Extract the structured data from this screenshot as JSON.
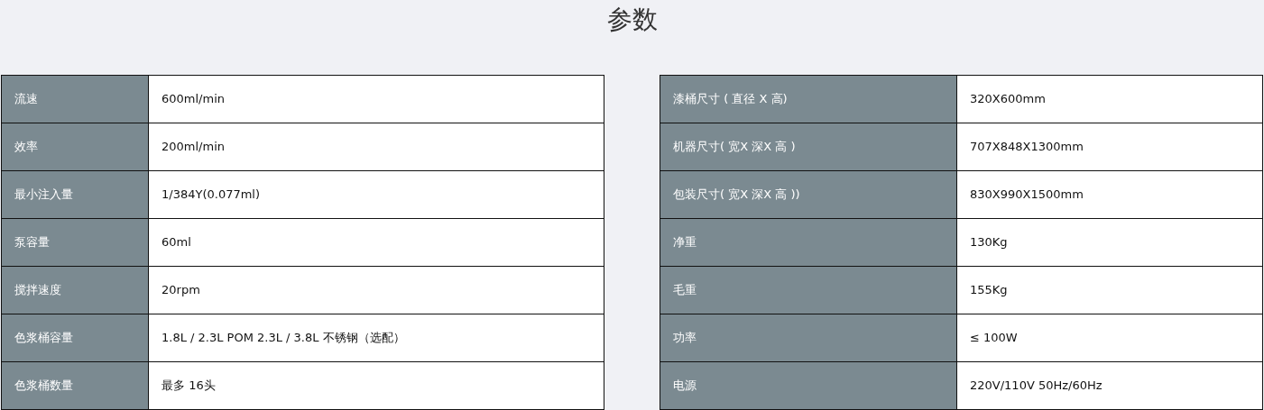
{
  "title": "参数",
  "tables": [
    {
      "rows": [
        {
          "label": "流速",
          "value": "600ml/min"
        },
        {
          "label": "效率",
          "value": "200ml/min"
        },
        {
          "label": "最小注入量",
          "value": "1/384Y(0.077ml)"
        },
        {
          "label": "泵容量",
          "value": "60ml"
        },
        {
          "label": "搅拌速度",
          "value": "20rpm"
        },
        {
          "label": "色浆桶容量",
          "value": "1.8L / 2.3L POM 2.3L / 3.8L 不锈钢（选配）"
        },
        {
          "label": "色浆桶数量",
          "value": "最多 16头"
        }
      ]
    },
    {
      "rows": [
        {
          "label": "漆桶尺寸 ( 直径 X 高)",
          "value": "320X600mm"
        },
        {
          "label": "机器尺寸( 宽X 深X 高 )",
          "value": "707X848X1300mm"
        },
        {
          "label": "包装尺寸( 宽X 深X 高 ))",
          "value": "830X990X1500mm"
        },
        {
          "label": "净重",
          "value": "130Kg"
        },
        {
          "label": "毛重",
          "value": "155Kg"
        },
        {
          "label": "功率",
          "value": "≤ 100W"
        },
        {
          "label": "电源",
          "value": "220V/110V 50Hz/60Hz"
        }
      ]
    }
  ]
}
